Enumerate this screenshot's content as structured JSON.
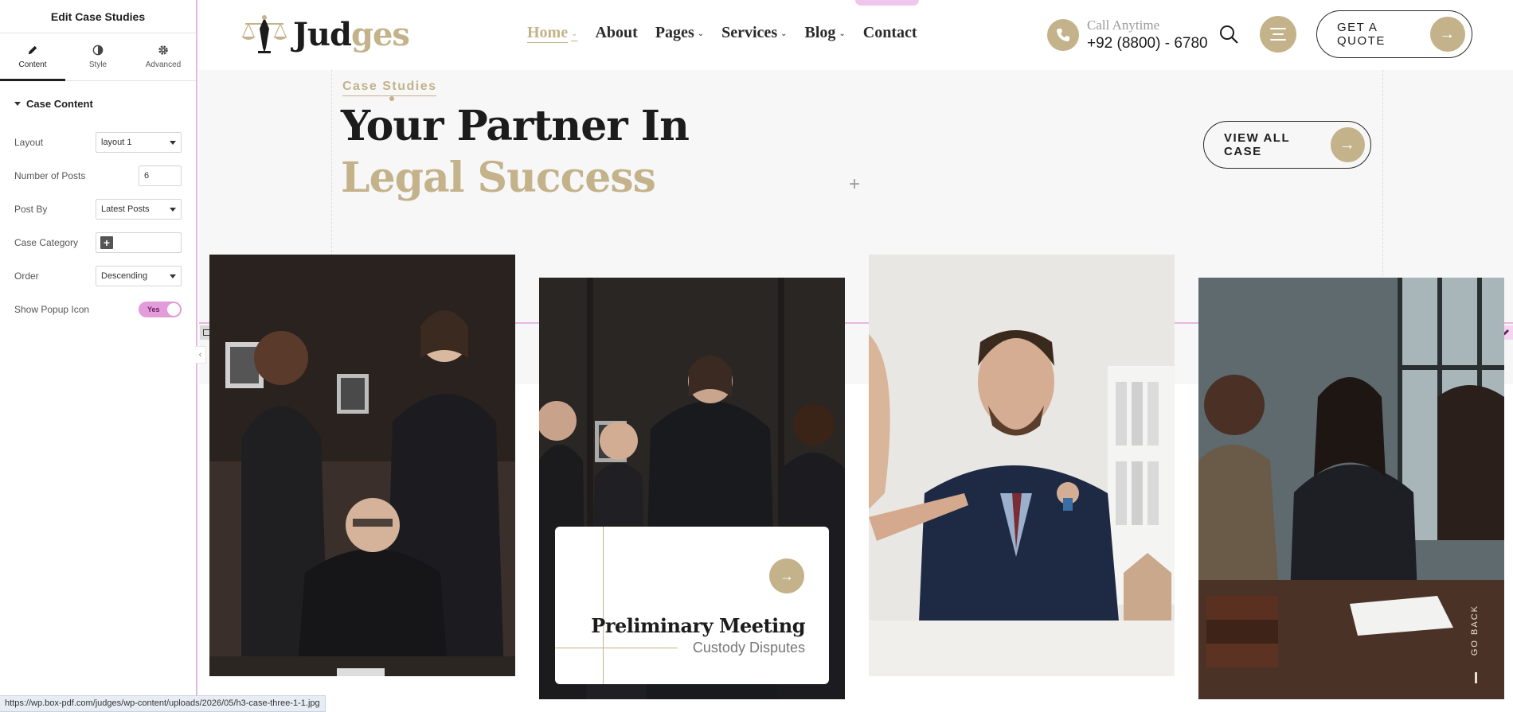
{
  "editor": {
    "title": "Edit Case Studies",
    "tabs": [
      {
        "label": "Content"
      },
      {
        "label": "Style"
      },
      {
        "label": "Advanced"
      }
    ],
    "section_title": "Case Content",
    "controls": {
      "layout": {
        "label": "Layout",
        "value": "layout 1"
      },
      "num_posts": {
        "label": "Number of Posts",
        "value": "6"
      },
      "post_by": {
        "label": "Post By",
        "value": "Latest Posts"
      },
      "case_category": {
        "label": "Case Category"
      },
      "order": {
        "label": "Order",
        "value": "Descending"
      },
      "show_popup": {
        "label": "Show Popup Icon",
        "value": "Yes"
      }
    }
  },
  "site": {
    "logo": {
      "part1": "Jud",
      "part2": "ges"
    },
    "nav": [
      {
        "label": "Home"
      },
      {
        "label": "About"
      },
      {
        "label": "Pages"
      },
      {
        "label": "Services"
      },
      {
        "label": "Blog"
      },
      {
        "label": "Contact"
      }
    ],
    "call": {
      "top": "Call Anytime",
      "number": "+92 (8800) - 6780"
    },
    "quote_button": "GET A QUOTE",
    "hero": {
      "eyebrow": "Case Studies",
      "line1": "Your Partner In",
      "line2": "Legal Success",
      "view_all": "VIEW ALL CASE"
    },
    "featured_case": {
      "title": "Preliminary Meeting",
      "subtitle": "Custody Disputes"
    },
    "go_back": "GO BACK"
  },
  "status_bar": "https://wp.box-pdf.com/judges/wp-content/uploads/2026/05/h3-case-three-1-1.jpg",
  "colors": {
    "accent": "#c3b28a",
    "editor_accent": "#e29cd9",
    "dark": "#1c1c1c"
  }
}
